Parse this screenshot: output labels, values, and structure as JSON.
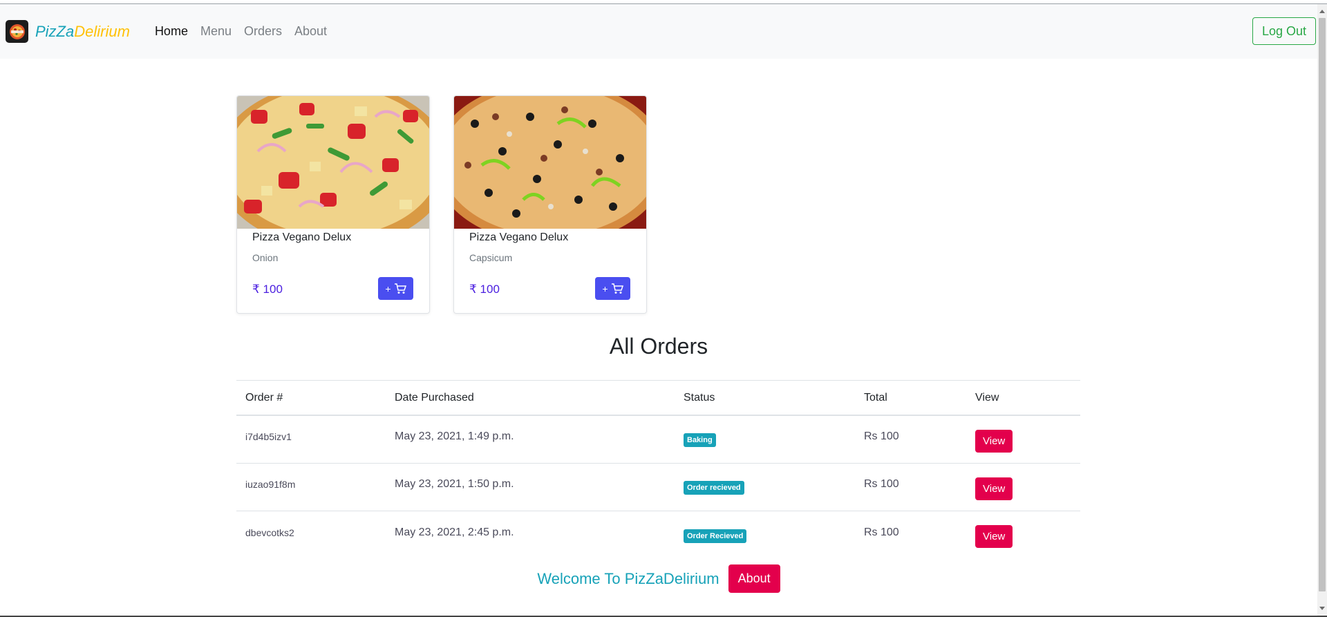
{
  "brand": {
    "part1": "PizZa",
    "part2": "Delirium",
    "logo_icon": "pizza-logo-icon"
  },
  "nav": {
    "items": [
      {
        "label": "Home",
        "active": true
      },
      {
        "label": "Menu",
        "active": false
      },
      {
        "label": "Orders",
        "active": false
      },
      {
        "label": "About",
        "active": false
      }
    ]
  },
  "header": {
    "logout_label": "Log Out"
  },
  "products": [
    {
      "name": "Pizza Vegano Delux",
      "topping": "Onion",
      "price": "₹ 100",
      "cart_label": "+",
      "cart_icon": "cart-icon"
    },
    {
      "name": "Pizza Vegano Delux",
      "topping": "Capsicum",
      "price": "₹ 100",
      "cart_label": "+",
      "cart_icon": "cart-icon"
    }
  ],
  "orders": {
    "title": "All Orders",
    "columns": [
      "Order #",
      "Date Purchased",
      "Status",
      "Total",
      "View"
    ],
    "rows": [
      {
        "id": "i7d4b5izv1",
        "date": "May 23, 2021, 1:49 p.m.",
        "status": "Baking",
        "total": "Rs 100",
        "view": "View"
      },
      {
        "id": "iuzao91f8m",
        "date": "May 23, 2021, 1:50 p.m.",
        "status": "Order recieved",
        "total": "Rs 100",
        "view": "View"
      },
      {
        "id": "dbevcotks2",
        "date": "May 23, 2021, 2:45 p.m.",
        "status": "Order Recieved",
        "total": "Rs 100",
        "view": "View"
      }
    ]
  },
  "footer": {
    "welcome": "Welcome To PizZaDelirium",
    "about_label": "About"
  },
  "colors": {
    "brand_teal": "#17a2b8",
    "brand_yellow": "#ffc107",
    "logout_green": "#28a745",
    "price_purple": "#4b1fe0",
    "cart_blue": "#4a4ef0",
    "view_red": "#e3004c",
    "badge_teal": "#17a2b8"
  }
}
